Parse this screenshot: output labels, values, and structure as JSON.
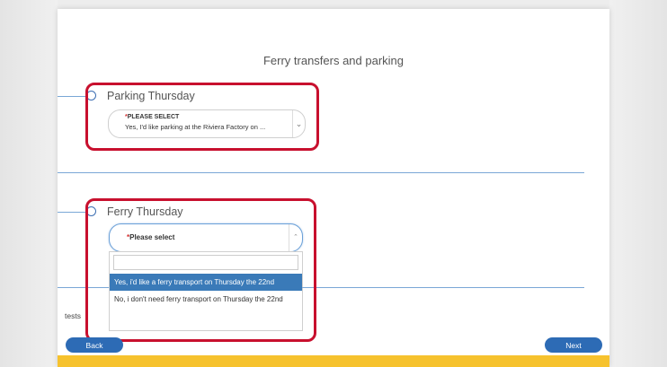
{
  "form": {
    "section_title": "Ferry transfers and parking",
    "parking": {
      "label": "Parking Thursday",
      "required_mark": "*",
      "placeholder": "PLEASE SELECT",
      "value": "Yes, I'd like parking at the Riviera Factory on ..."
    },
    "ferry": {
      "label": "Ferry Thursday",
      "required_mark": "*",
      "placeholder": "Please select",
      "search_value": "",
      "options": [
        "Yes, i'd like a ferry transport on Thursday the 22nd",
        "No, i don't need ferry transport on Thursday the 22nd"
      ]
    },
    "partial_text": "tests"
  },
  "nav": {
    "back_label": "Back",
    "next_label": "Next"
  },
  "colors": {
    "highlight": "#c8102e",
    "accent": "#2d6bb5",
    "footer": "#f6c22e"
  },
  "icons": {
    "dropdown_closed": "chevron-down-icon",
    "dropdown_open": "chevron-up-icon"
  }
}
